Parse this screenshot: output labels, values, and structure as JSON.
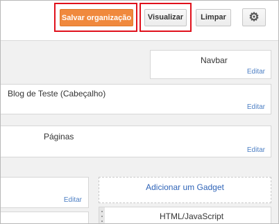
{
  "toolbar": {
    "save_label": "Salvar organização",
    "preview_label": "Visualizar",
    "clear_label": "Limpar",
    "settings_icon": "gear-icon"
  },
  "layout": {
    "navbar": {
      "title": "Navbar",
      "edit": "Editar"
    },
    "header": {
      "title": "Blog de Teste (Cabeçalho)",
      "edit": "Editar"
    },
    "pages": {
      "title": "Páginas",
      "edit": "Editar"
    },
    "sidebar_left": {
      "edit": "Editar"
    },
    "add_gadget": "Adicionar um Gadget",
    "html_widget": {
      "title": "HTML/JavaScript"
    }
  },
  "colors": {
    "save_button": "#f0893d",
    "highlight": "#e0101b",
    "link": "#4d7fc4"
  }
}
